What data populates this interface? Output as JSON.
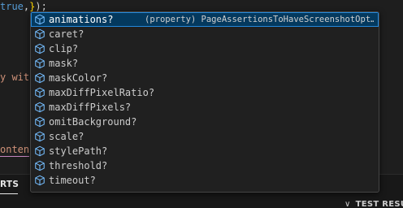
{
  "editor": {
    "line_top": {
      "value": "true",
      "punct": ",",
      "brace": "}",
      "paren": ")",
      "semi": ";"
    },
    "line_mid": "y wit",
    "line_low": "onten"
  },
  "suggest": {
    "items": [
      {
        "label": "animations?",
        "detail": "(property) PageAssertionsToHaveScreenshotOpt…",
        "selected": true
      },
      {
        "label": "caret?"
      },
      {
        "label": "clip?"
      },
      {
        "label": "mask?"
      },
      {
        "label": "maskColor?"
      },
      {
        "label": "maxDiffPixelRatio?"
      },
      {
        "label": "maxDiffPixels?"
      },
      {
        "label": "omitBackground?"
      },
      {
        "label": "scale?"
      },
      {
        "label": "stylePath?"
      },
      {
        "label": "threshold?"
      },
      {
        "label": "timeout?"
      }
    ],
    "icon": "cube-property-icon",
    "colors": {
      "selected_bg": "#04395e",
      "selected_border": "#2488db",
      "icon": "#75beff"
    }
  },
  "panel": {
    "tab_label": "RTS",
    "test_results_label": "TEST RESU",
    "chevron": "∨"
  }
}
